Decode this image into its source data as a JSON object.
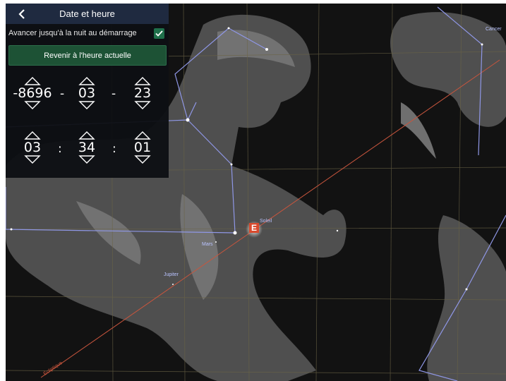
{
  "panel": {
    "title": "Date et heure",
    "back_icon": "chevron-left-icon",
    "auto_night_label": "Avancer jusqu'à la nuit au démarrage",
    "auto_night_checked": true,
    "reset_button_label": "Revenir à l'heure actuelle"
  },
  "date": {
    "year": "-8696",
    "month": "03",
    "day": "23",
    "separator": "-"
  },
  "time": {
    "hour": "03",
    "minute": "34",
    "second": "01",
    "separator": ":"
  },
  "sky": {
    "constellation_label": "Cancer",
    "objects": {
      "sun": "Soleil",
      "mars": "Mars",
      "jupiter": "Jupiter"
    },
    "ecliptic_label": "Écliptique",
    "colors": {
      "background": "#121212",
      "constellation_lines": "#8f97e6",
      "grid": "#6b6446",
      "ecliptic": "#c8553d",
      "checkbox": "#1f6f4a",
      "reset_button": "#1d5235"
    }
  }
}
